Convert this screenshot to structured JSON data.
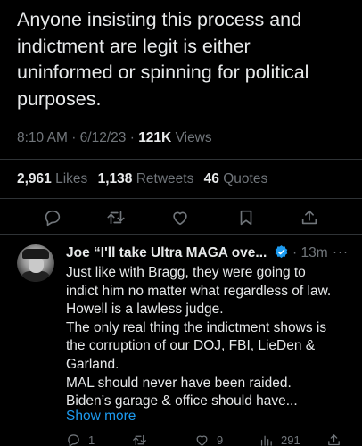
{
  "tweet": {
    "text": "Anyone insisting this process and\nindictment are legit is either\nuninformed or spinning for political\npurposes.",
    "time": "8:10 AM",
    "separator": "·",
    "date": "6/12/23",
    "views_count": "121K",
    "views_label": "Views"
  },
  "stats": {
    "likes_count": "2,961",
    "likes_label": "Likes",
    "retweets_count": "1,138",
    "retweets_label": "Retweets",
    "quotes_count": "46",
    "quotes_label": "Quotes"
  },
  "actions": [
    "reply-icon",
    "retweet-icon",
    "like-icon",
    "bookmark-icon",
    "share-icon"
  ],
  "reply": {
    "name": "Joe “I'll take Ultra MAGA ove...",
    "separator": "·",
    "time": "13m",
    "more": "···",
    "text": "Just like with Bragg, they were going to\nindict him no matter what regardless of law.\nHowell is a lawless judge.\nThe only real thing the indictment shows is\nthe corruption of our DOJ, FBI, LieDen &\nGarland.\nMAL should never have been raided.\nBiden’s garage & office should have...",
    "show_more": "Show more",
    "reply_count": "1",
    "like_count": "9",
    "views_count": "291"
  },
  "colors": {
    "background": "#000000",
    "text": "#e7e9ea",
    "muted": "#71767b",
    "accent": "#1d9bf0",
    "divider": "#2f3336"
  }
}
